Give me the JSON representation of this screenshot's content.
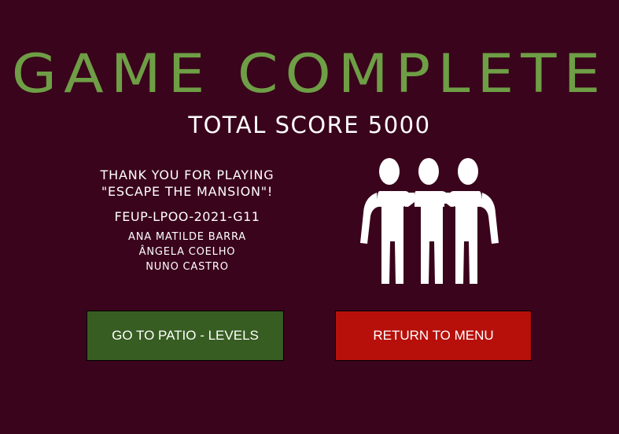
{
  "screen": {
    "title": "GAME COMPLETE",
    "score_label": "TOTAL SCORE 5000"
  },
  "credits": {
    "thanks_line1": "THANK YOU FOR PLAYING",
    "thanks_line2": "\"ESCAPE THE MANSION\"!",
    "group_code": "FEUP-LPOO-2021-G11",
    "names": [
      "ANA MATILDE BARRA",
      "ÂNGELA COELHO",
      "NUNO CASTRO"
    ]
  },
  "illustration": {
    "icon": "people-group-icon"
  },
  "buttons": {
    "patio_label": "GO TO PATIO - LEVELS",
    "menu_label": "RETURN TO MENU"
  },
  "colors": {
    "background": "#3a041c",
    "title": "#6e9e45",
    "patio_button": "#375d22",
    "menu_button": "#b7100b",
    "text": "#ffffff"
  }
}
